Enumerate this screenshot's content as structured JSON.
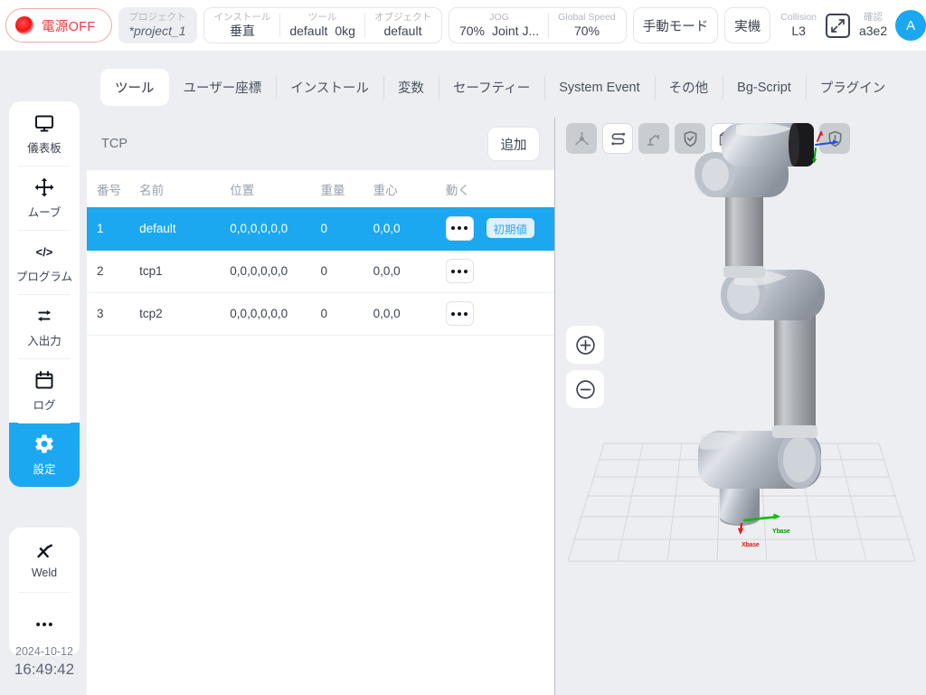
{
  "topbar": {
    "power": {
      "label": "電源OFF",
      "icon": "power-indicator-dot"
    },
    "project": {
      "title": "プロジェクト",
      "value": "*project_1"
    },
    "install": {
      "title": "インストール",
      "value": "垂直"
    },
    "tool": {
      "title": "ツール",
      "value": "default",
      "payload": "0kg"
    },
    "object": {
      "title": "オブジェクト",
      "value": "default"
    },
    "jog": {
      "title": "JOG",
      "speed": "70%",
      "mode": "Joint J..."
    },
    "global_speed": {
      "title": "Global Speed",
      "value": "70%"
    },
    "mode_button": "手動モード",
    "real_button": "実機",
    "collision": {
      "title": "Collision",
      "value": "L3"
    },
    "expand_icon": "expand-arrows-icon",
    "confirm": {
      "title": "確認",
      "value": "a3e2"
    },
    "avatar": {
      "initial": "A",
      "color": "#1ba8f0"
    }
  },
  "tabs": [
    {
      "label": "ツール",
      "active": true
    },
    {
      "label": "ユーザー座標",
      "active": false
    },
    {
      "label": "インストール",
      "active": false
    },
    {
      "label": "変数",
      "active": false
    },
    {
      "label": "セーフティー",
      "active": false
    },
    {
      "label": "System Event",
      "active": false
    },
    {
      "label": "その他",
      "active": false
    },
    {
      "label": "Bg-Script",
      "active": false
    },
    {
      "label": "プラグイン",
      "active": false
    }
  ],
  "sidebar": {
    "items": [
      {
        "label": "儀表板",
        "icon": "monitor-icon",
        "active": false
      },
      {
        "label": "ムーブ",
        "icon": "move-arrows-icon",
        "active": false
      },
      {
        "label": "プログラム",
        "icon": "code-brackets-icon",
        "active": false
      },
      {
        "label": "入出力",
        "icon": "swap-arrows-icon",
        "active": false
      },
      {
        "label": "ログ",
        "icon": "calendar-icon",
        "active": false
      },
      {
        "label": "設定",
        "icon": "gear-icon",
        "active": true
      }
    ],
    "extra": [
      {
        "label": "Weld",
        "icon": "weld-torch-icon"
      },
      {
        "label": "",
        "icon": "ellipsis-icon"
      }
    ],
    "clock": {
      "date": "2024-10-12",
      "time": "16:49:42"
    }
  },
  "panel": {
    "title": "TCP",
    "add_label": "追加",
    "columns": [
      "番号",
      "名前",
      "位置",
      "重量",
      "重心",
      "動く"
    ],
    "rows": [
      {
        "no": "1",
        "name": "default",
        "pos": "0,0,0,0,0,0",
        "weight": "0",
        "cog": "0,0,0",
        "badge": "初期値",
        "selected": true
      },
      {
        "no": "2",
        "name": "tcp1",
        "pos": "0,0,0,0,0,0",
        "weight": "0",
        "cog": "0,0,0",
        "badge": "",
        "selected": false
      },
      {
        "no": "3",
        "name": "tcp2",
        "pos": "0,0,0,0,0,0",
        "weight": "0",
        "cog": "0,0,0",
        "badge": "",
        "selected": false
      }
    ]
  },
  "viewport": {
    "toolbar": [
      {
        "name": "axis-tripod-icon",
        "on": false
      },
      {
        "name": "trajectory-path-icon",
        "on": true
      },
      {
        "name": "robot-arm-icon",
        "on": false
      },
      {
        "name": "shield-check-icon",
        "on": false
      },
      {
        "name": "cube-solid-icon",
        "on": true
      },
      {
        "name": "cube-wire-icon",
        "on": true
      },
      {
        "name": "cube-shaded-icon",
        "on": true
      },
      {
        "name": "shield-alert-icon",
        "on": false
      }
    ],
    "zoom_in": "+",
    "zoom_out": "−",
    "axis_labels": {
      "x": "Xbase",
      "y": "Ybase"
    }
  }
}
